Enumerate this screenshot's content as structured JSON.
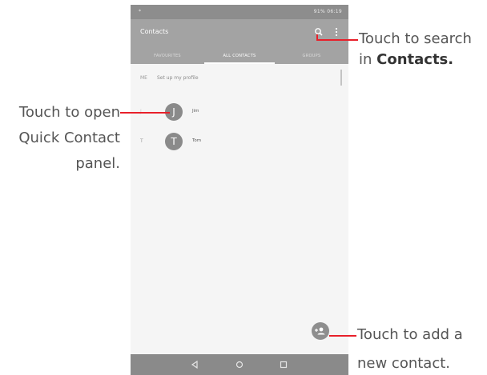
{
  "status_bar": {
    "left": "*",
    "right": "91% 06:19"
  },
  "app_bar": {
    "title": "Contacts"
  },
  "tabs": [
    {
      "label": "FAVOURITES"
    },
    {
      "label": "ALL CONTACTS"
    },
    {
      "label": "GROUPS"
    }
  ],
  "profile": {
    "letter": "ME",
    "text": "Set up my profile"
  },
  "contacts": [
    {
      "letter": "J",
      "initial": "J",
      "name": "Jim"
    },
    {
      "letter": "T",
      "initial": "T",
      "name": "Tom"
    }
  ],
  "callouts": {
    "search": {
      "line1": "Touch to search",
      "line2_prefix": "in ",
      "line2_bold": "Contacts."
    },
    "quick_contact": {
      "line1": "Touch to open",
      "line2": "Quick Contact",
      "line3": "panel."
    },
    "add_contact": {
      "line1": "Touch to add a",
      "line2": "new contact."
    }
  },
  "colors": {
    "callout_line": "#e8202a",
    "app_bar": "#a3a3a3"
  }
}
